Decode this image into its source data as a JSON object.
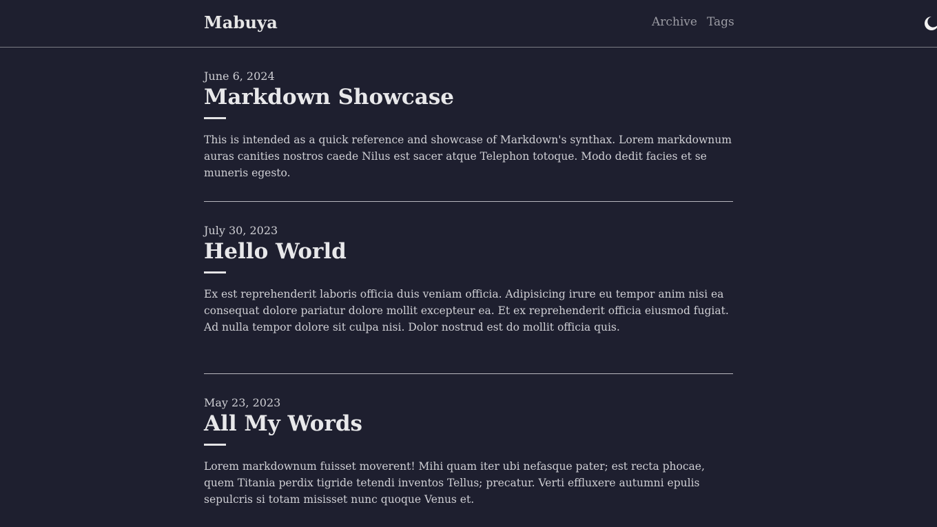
{
  "header": {
    "site_title": "Mabuya",
    "nav": {
      "archive": "Archive",
      "tags": "Tags"
    },
    "theme_icon": "moon-icon"
  },
  "posts": [
    {
      "date": "June 6, 2024",
      "title": "Markdown Showcase",
      "excerpt": "This is intended as a quick reference and showcase of Markdown's synthax. Lorem markdownum auras canities nostros caede Nilus est sacer atque Telephon totoque. Modo dedit facies et se muneris egesto."
    },
    {
      "date": "July 30, 2023",
      "title": "Hello World",
      "excerpt": "Ex est reprehenderit laboris officia duis veniam officia. Adipisicing irure eu tempor anim nisi ea consequat dolore pariatur dolore mollit excepteur ea. Et ex reprehenderit officia eiusmod fugiat. Ad nulla tempor dolore sit culpa nisi. Dolor nostrud est do mollit officia quis."
    },
    {
      "date": "May 23, 2023",
      "title": "All My Words",
      "excerpt": "Lorem markdownum fuisset moverent! Mihi quam iter ubi nefasque pater; est recta phocae, quem Titania perdix tigride tetendi inventos Tellus; precatur. Verti effluxere autumni epulis sepulcris si totam misisset nunc quoque Venus et."
    }
  ]
}
